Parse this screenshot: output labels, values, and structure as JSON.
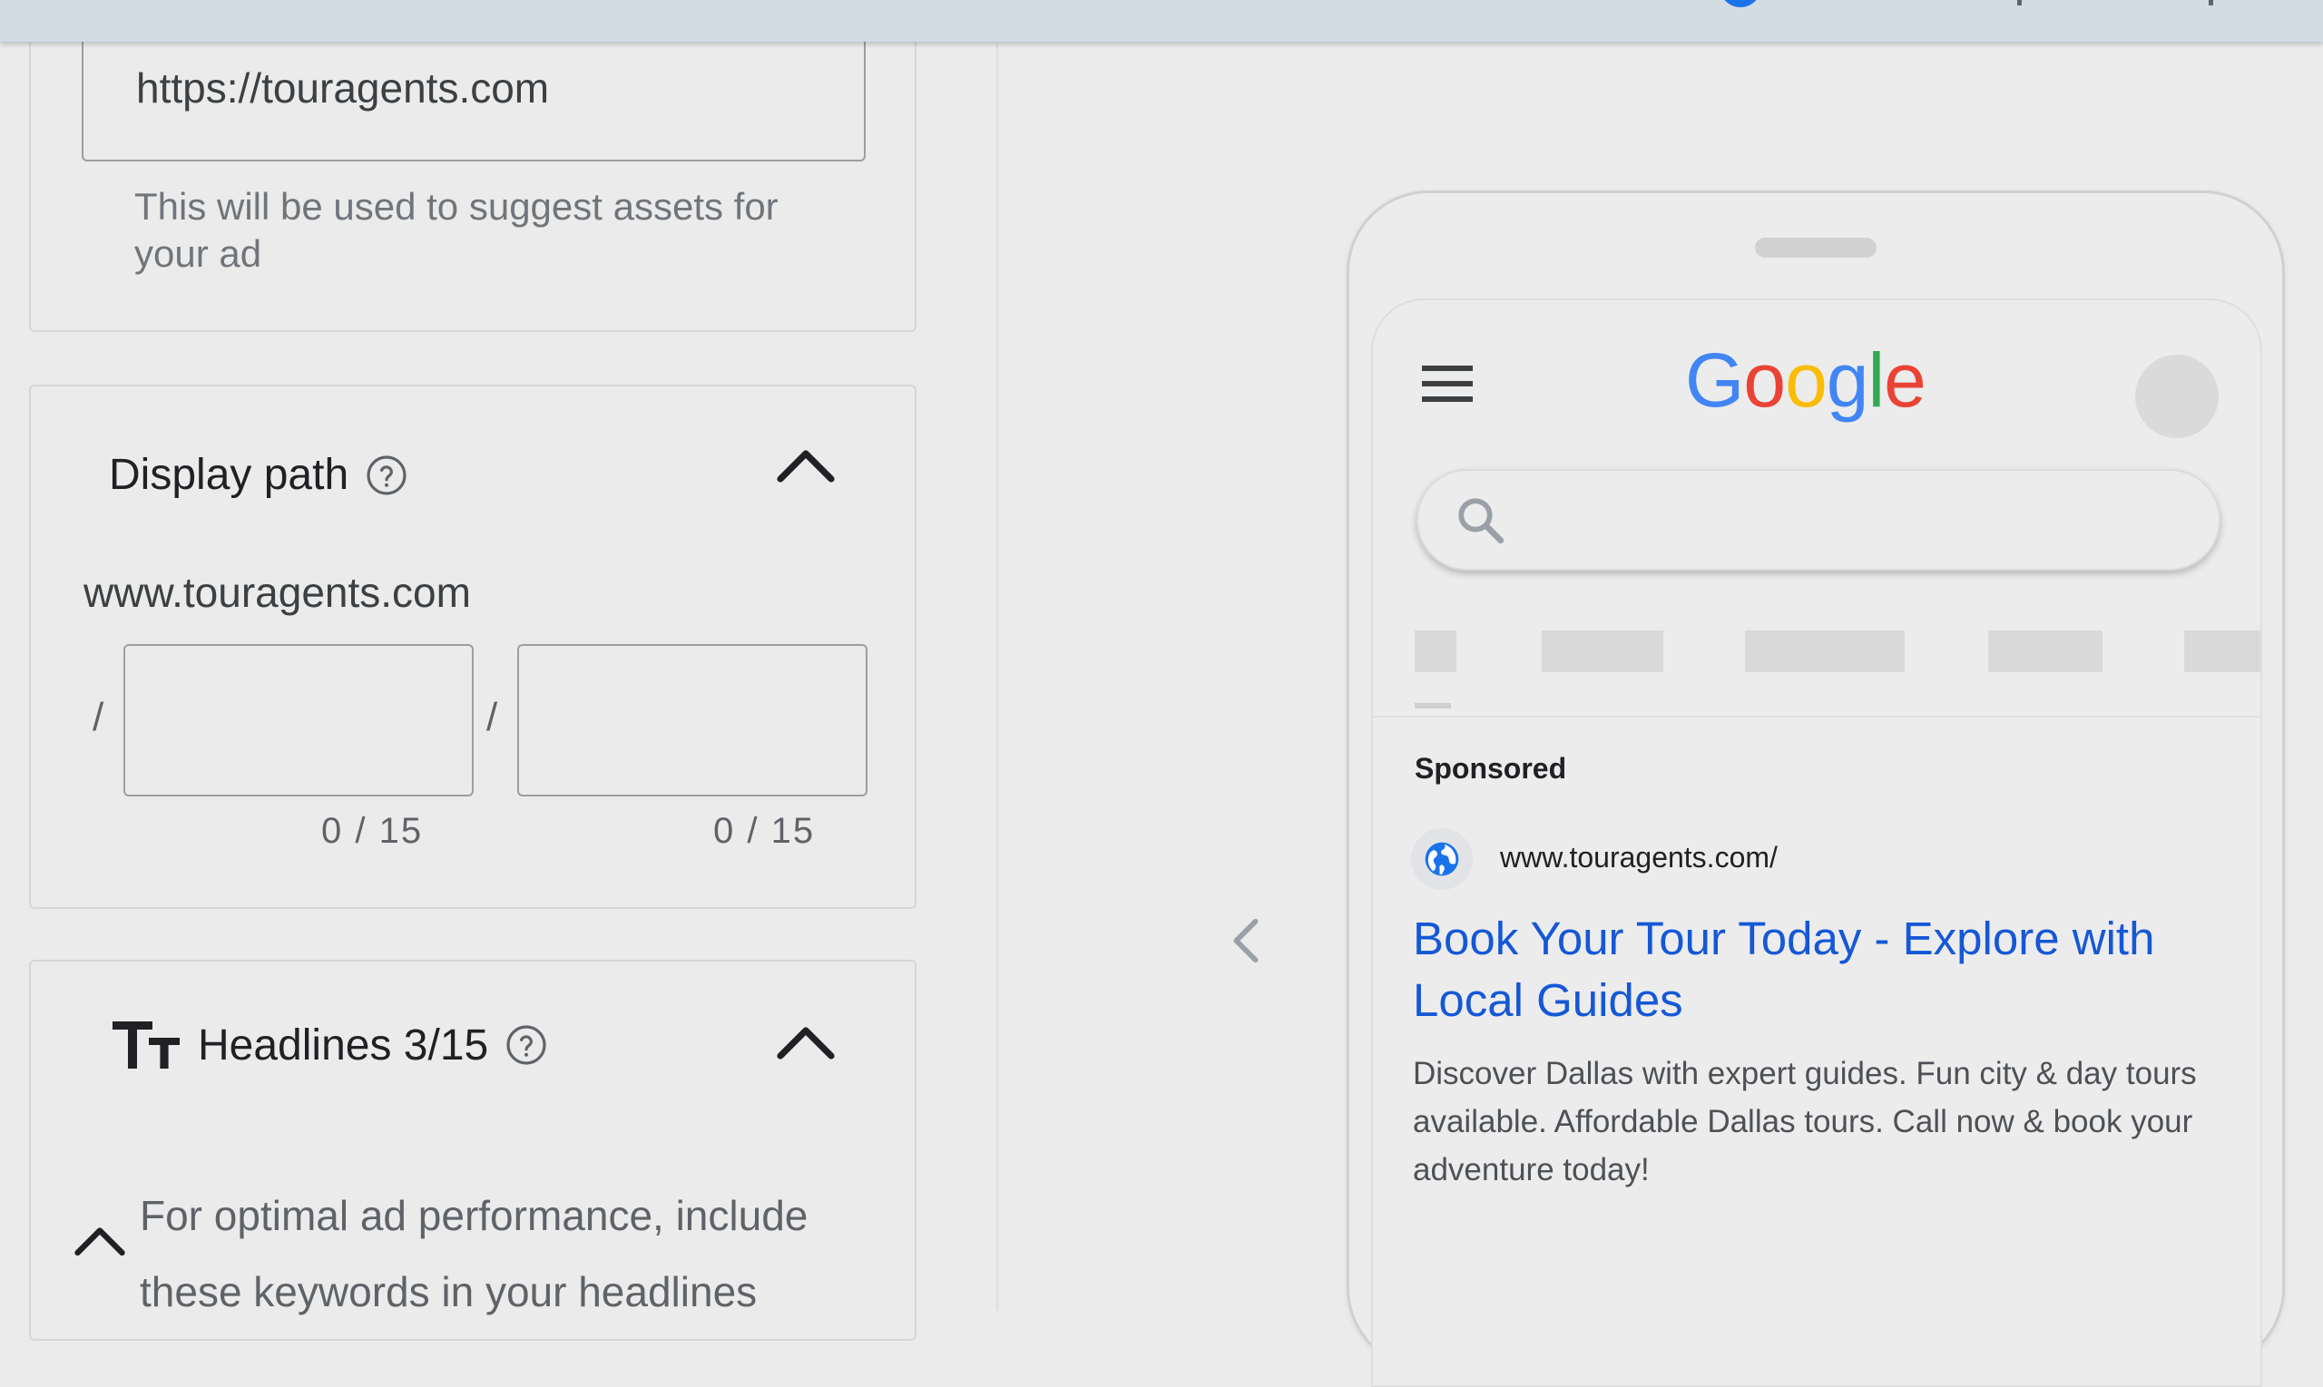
{
  "url_card": {
    "final_url_value": "https://touragents.com",
    "help_text": "This will be used to suggest assets for your ad"
  },
  "display_path": {
    "title": "Display path",
    "base_url": "www.touragents.com",
    "separator": "/",
    "path1": {
      "value": "",
      "counter": "0 / 15"
    },
    "path2": {
      "value": "",
      "counter": "0 / 15"
    }
  },
  "headlines": {
    "title": "Headlines 3/15",
    "keyword_note": "For optimal ad performance, include these keywords in your headlines"
  },
  "preview": {
    "logo": [
      "G",
      "o",
      "o",
      "g",
      "l",
      "e"
    ],
    "sponsored_label": "Sponsored",
    "display_url": "www.touragents.com/",
    "ad_headline": "Book Your Tour Today - Explore with Local Guides",
    "ad_description": "Discover Dallas with expert guides. Fun city & day tours available. Affordable Dallas tours. Call now & book your adventure today!"
  },
  "icons": {
    "help": "help-circle-icon",
    "collapse": "chevron-up-icon",
    "text_format": "text-format-icon",
    "menu": "hamburger-menu-icon",
    "search": "search-icon",
    "globe": "globe-icon",
    "previous": "chevron-left-icon"
  },
  "colors": {
    "link_blue": "#1558d6",
    "google_blue": "#4285f4",
    "google_red": "#ea4335",
    "google_yellow": "#fbbc05",
    "google_green": "#34a853"
  }
}
